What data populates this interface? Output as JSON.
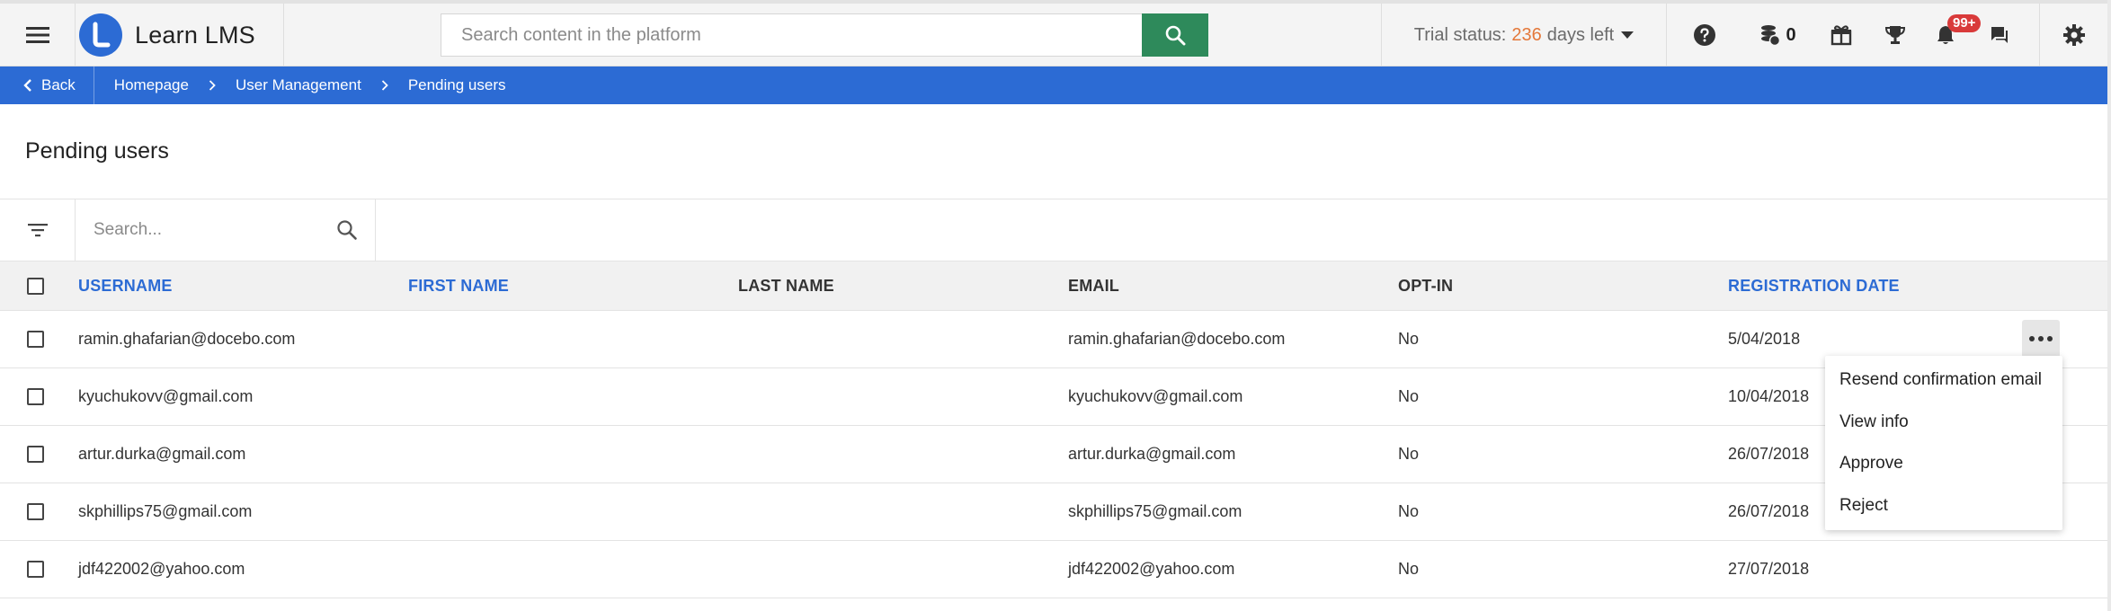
{
  "header": {
    "brand_name": "Learn LMS",
    "search_placeholder": "Search content in the platform",
    "trial_prefix": "Trial status:",
    "trial_days": "236",
    "trial_suffix": "days left",
    "coins": "0",
    "notifications_badge": "99+",
    "icons": [
      "menu-icon",
      "brand-logo-icon",
      "search-icon",
      "help-icon",
      "coins-icon",
      "gift-icon",
      "trophy-icon",
      "bell-icon",
      "chat-icon",
      "gear-icon"
    ],
    "accent_color": "#2c6bd4",
    "search_button_color": "#2e8a5b",
    "trial_days_color": "#e4783a",
    "badge_color": "#d93a3a"
  },
  "breadcrumb": {
    "back_label": "Back",
    "items": [
      "Homepage",
      "User Management",
      "Pending users"
    ]
  },
  "page": {
    "title": "Pending users"
  },
  "table": {
    "search_placeholder": "Search...",
    "columns": {
      "username": "USERNAME",
      "first_name": "FIRST NAME",
      "last_name": "LAST NAME",
      "email": "EMAIL",
      "opt_in": "OPT-IN",
      "registration_date": "REGISTRATION DATE"
    },
    "rows": [
      {
        "username": "ramin.ghafarian@docebo.com",
        "first_name": "",
        "last_name": "",
        "email": "ramin.ghafarian@docebo.com",
        "opt_in": "No",
        "registration_date": "5/04/2018"
      },
      {
        "username": "kyuchukovv@gmail.com",
        "first_name": "",
        "last_name": "",
        "email": "kyuchukovv@gmail.com",
        "opt_in": "No",
        "registration_date": "10/04/2018"
      },
      {
        "username": "artur.durka@gmail.com",
        "first_name": "",
        "last_name": "",
        "email": "artur.durka@gmail.com",
        "opt_in": "No",
        "registration_date": "26/07/2018"
      },
      {
        "username": "skphillips75@gmail.com",
        "first_name": "",
        "last_name": "",
        "email": "skphillips75@gmail.com",
        "opt_in": "No",
        "registration_date": "26/07/2018"
      },
      {
        "username": "jdf422002@yahoo.com",
        "first_name": "",
        "last_name": "",
        "email": "jdf422002@yahoo.com",
        "opt_in": "No",
        "registration_date": "27/07/2018"
      }
    ]
  },
  "row_menu": {
    "items": [
      "Resend confirmation email",
      "View info",
      "Approve",
      "Reject"
    ]
  }
}
